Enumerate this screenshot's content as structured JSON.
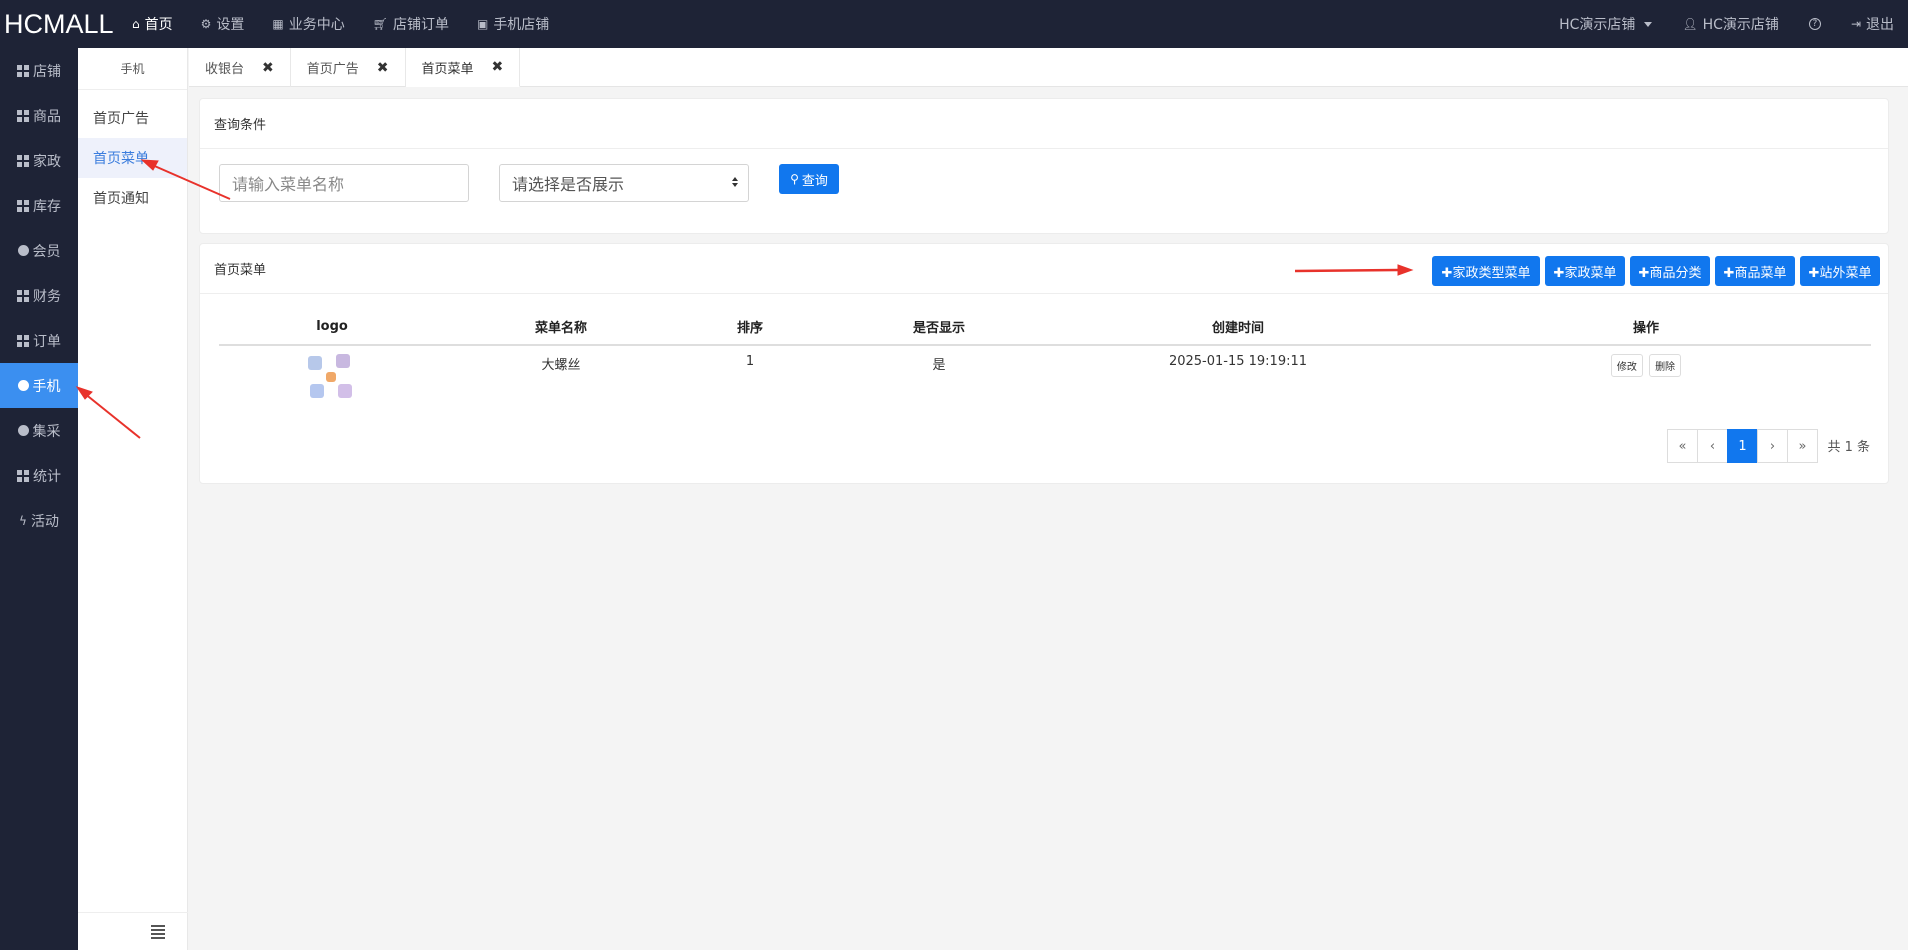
{
  "brand": "HCMALL",
  "topnav": {
    "items": [
      {
        "label": "首页",
        "icon": "home-icon"
      },
      {
        "label": "设置",
        "icon": "gear-icon"
      },
      {
        "label": "业务中心",
        "icon": "calculator-icon"
      },
      {
        "label": "店铺订单",
        "icon": "cart-icon"
      },
      {
        "label": "手机店铺",
        "icon": "qrcode-icon"
      }
    ],
    "store_select": "HC演示店铺",
    "user": "HC演示店铺",
    "logout": "退出"
  },
  "rail": {
    "items": [
      "店铺",
      "商品",
      "家政",
      "库存",
      "会员",
      "财务",
      "订单",
      "手机",
      "集采",
      "统计",
      "活动"
    ],
    "active": "手机"
  },
  "subside": {
    "title": "手机",
    "items": [
      "首页广告",
      "首页菜单",
      "首页通知"
    ],
    "active": "首页菜单"
  },
  "tabs": [
    {
      "label": "收银台",
      "close": "✖"
    },
    {
      "label": "首页广告",
      "close": "✖"
    },
    {
      "label": "首页菜单",
      "close": "✖"
    }
  ],
  "query": {
    "title": "查询条件",
    "name_placeholder": "请输入菜单名称",
    "display_select": "请选择是否展示",
    "search_button": "查询"
  },
  "list": {
    "title": "首页菜单",
    "buttons": [
      "✚家政类型菜单",
      "✚家政菜单",
      "✚商品分类",
      "✚商品菜单",
      "✚站外菜单"
    ],
    "columns": [
      "logo",
      "菜单名称",
      "排序",
      "是否显示",
      "创建时间",
      "操作"
    ],
    "rows": [
      {
        "name": "大螺丝",
        "sort": "1",
        "show": "是",
        "created": "2025-01-15 19:19:11",
        "edit": "修改",
        "delete": "删除"
      }
    ],
    "pager": {
      "first": "«",
      "prev": "‹",
      "page": "1",
      "next": "›",
      "last": "»"
    },
    "total": "共 1 条"
  },
  "colors": {
    "nav_bg": "#1e2336",
    "accent": "#1177ee",
    "rail_active": "#3b8ff0",
    "annotation_arrow": "#e8322b"
  }
}
